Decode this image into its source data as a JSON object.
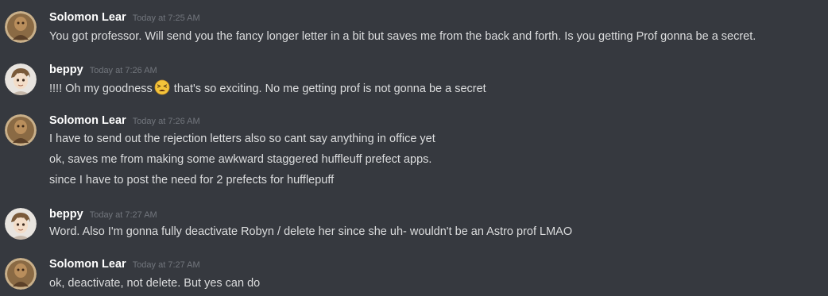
{
  "messages": [
    {
      "username": "Solomon Lear",
      "timestamp": "Today at 7:25 AM",
      "lines": [
        "You got professor. Will send you the fancy longer letter in a bit but saves me from the back and forth. Is you getting Prof gonna be a secret."
      ]
    },
    {
      "username": "beppy",
      "timestamp": "Today at 7:26 AM",
      "line_before_emoji": "!!!! Oh my goodness",
      "emoji": "tired-face-emoji",
      "line_after_emoji": "that's so exciting. No me getting prof is not gonna be a secret"
    },
    {
      "username": "Solomon Lear",
      "timestamp": "Today at 7:26 AM",
      "lines": [
        "I have to send out the rejection letters also so cant say anything in office yet",
        "ok, saves me from making some awkward staggered huffleuff prefect apps.",
        "since I have to post the need for 2 prefects for hufflepuff"
      ]
    },
    {
      "username": "beppy",
      "timestamp": "Today at 7:27 AM",
      "lines": [
        "Word. Also I'm gonna fully deactivate Robyn / delete her since she uh- wouldn't be an Astro prof LMAO"
      ]
    },
    {
      "username": "Solomon Lear",
      "timestamp": "Today at 7:27 AM",
      "lines": [
        "ok, deactivate, not delete. But yes can do"
      ]
    }
  ],
  "colors": {
    "background": "#36393f",
    "username": "#ffffff",
    "timestamp": "#72767d",
    "text": "#dcddde"
  }
}
